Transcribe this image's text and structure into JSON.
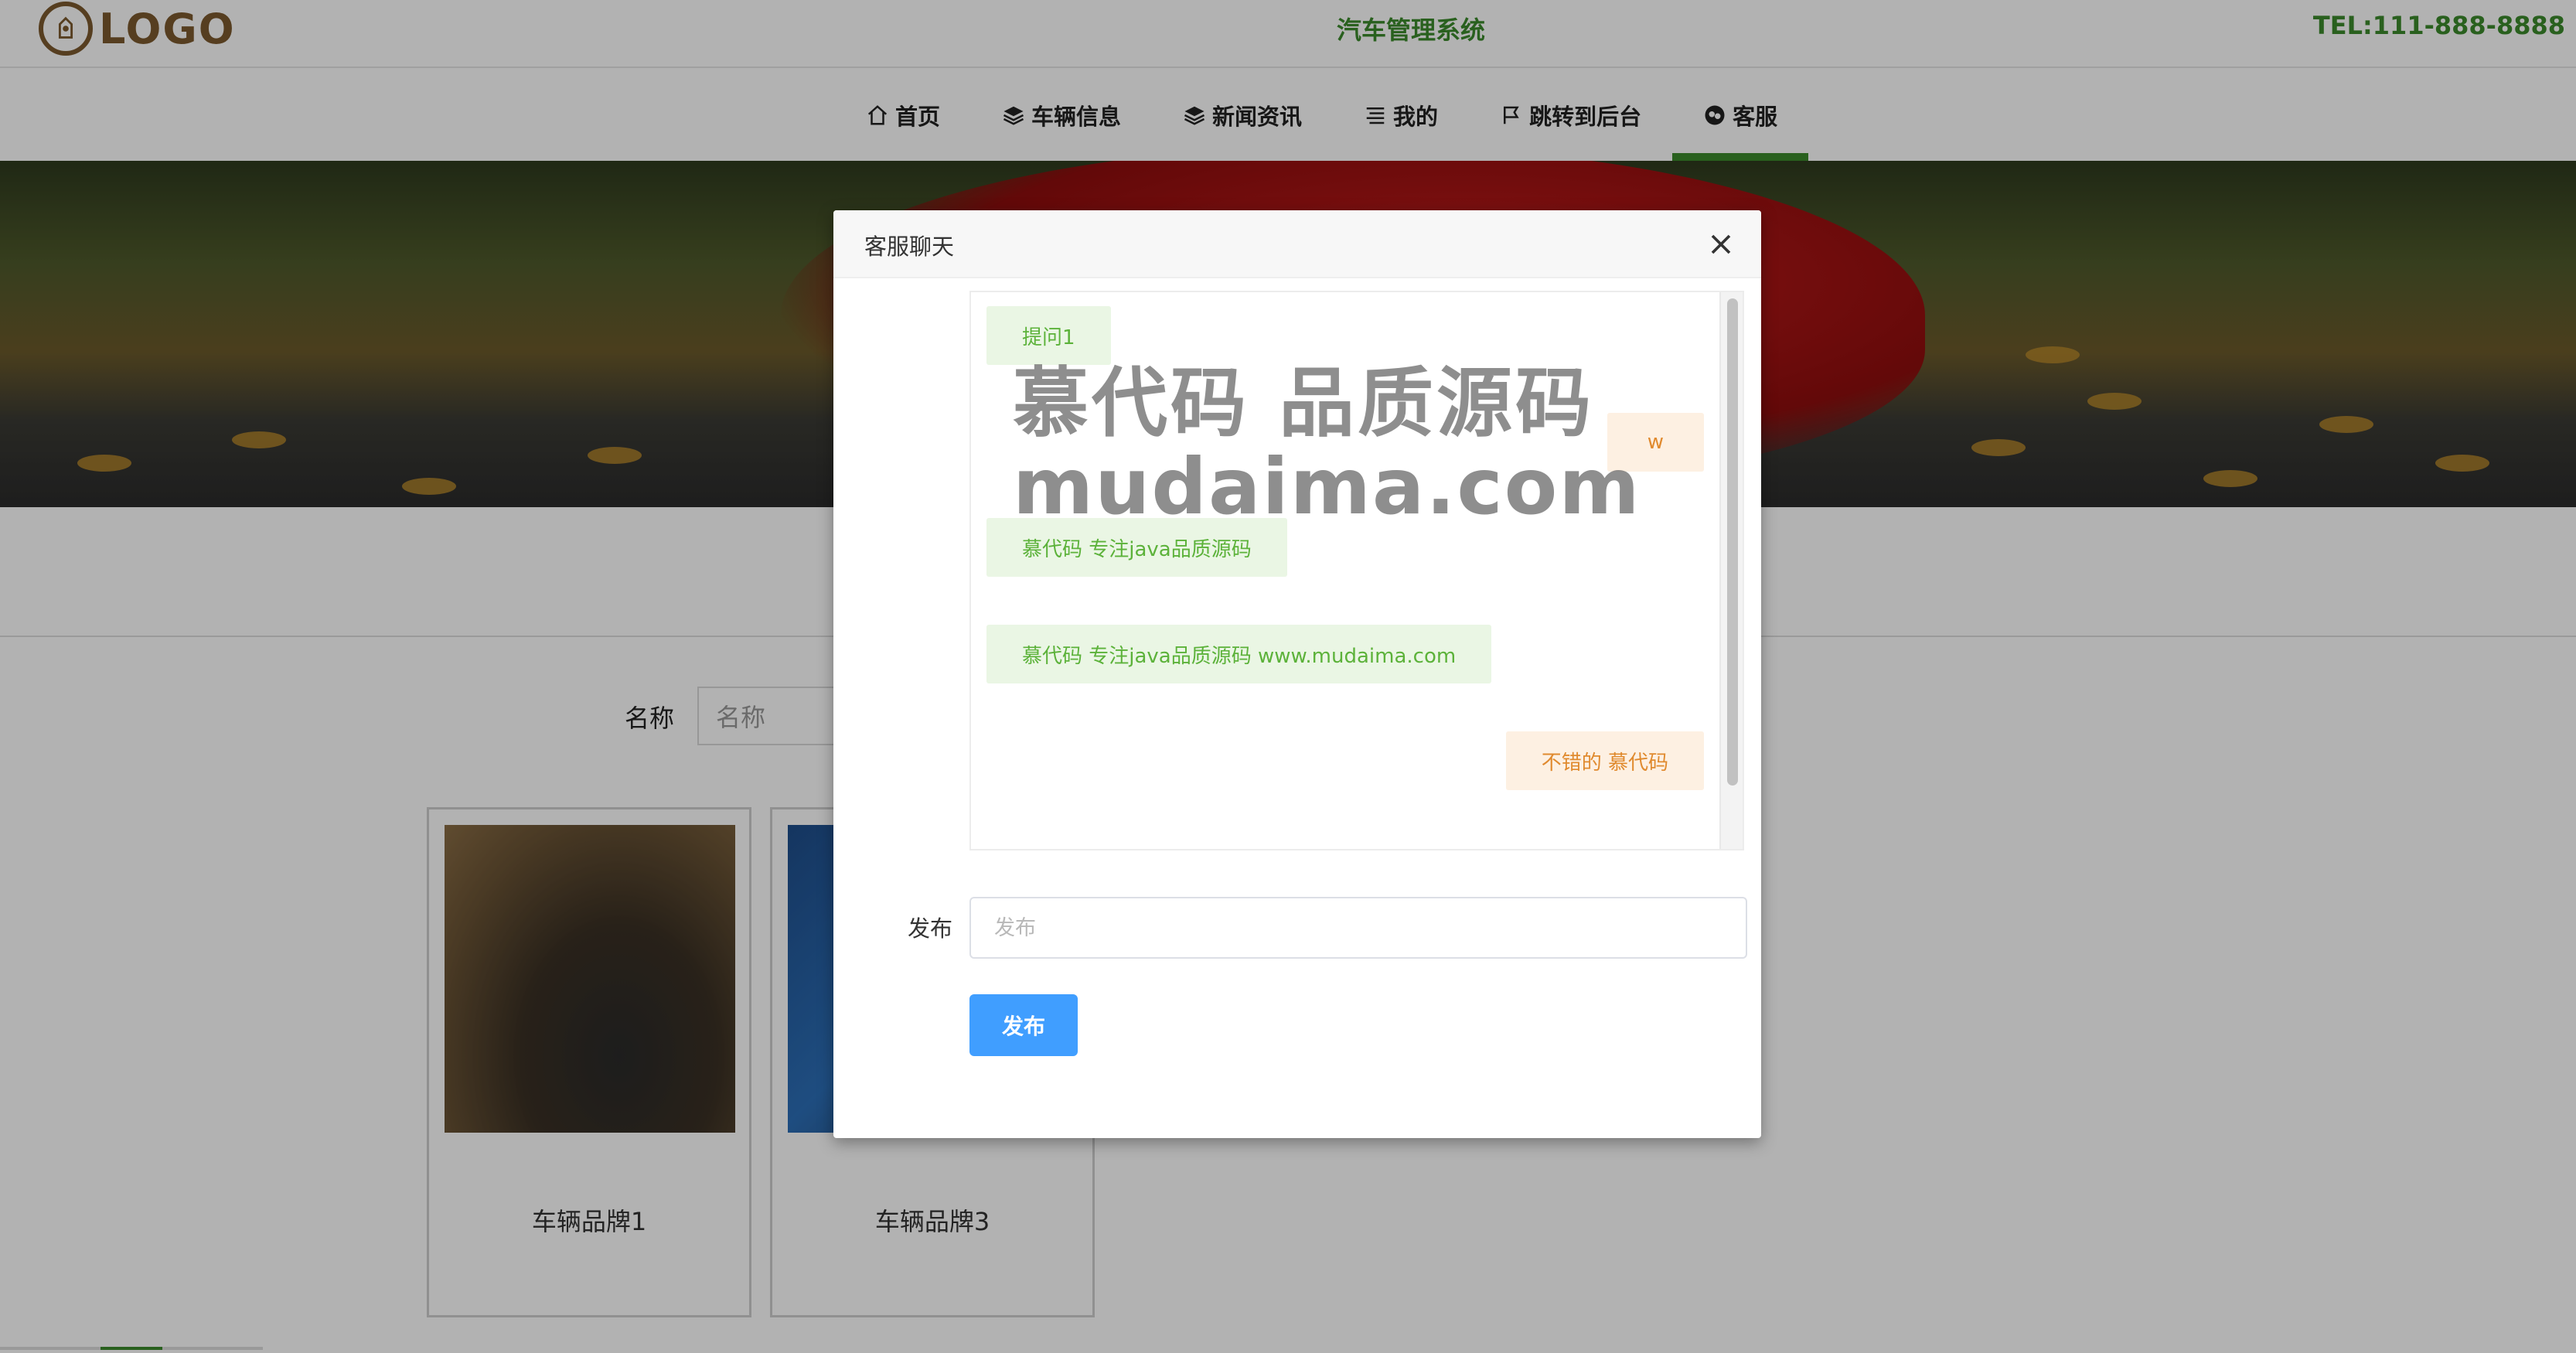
{
  "header": {
    "logo_text": "LOGO",
    "title": "汽车管理系统",
    "tel": "TEL:111-888-8888"
  },
  "nav": {
    "items": [
      {
        "label": "首页",
        "icon": "home-icon"
      },
      {
        "label": "车辆信息",
        "icon": "layers-icon"
      },
      {
        "label": "新闻资讯",
        "icon": "layers-icon"
      },
      {
        "label": "我的",
        "icon": "list-icon"
      },
      {
        "label": "跳转到后台",
        "icon": "flag-icon"
      },
      {
        "label": "客服",
        "icon": "wechat-icon"
      }
    ],
    "active_index": 5,
    "active_color": "#3b8a2c"
  },
  "search": {
    "label": "名称",
    "placeholder": "名称"
  },
  "cards": [
    {
      "label": "车辆品牌1"
    },
    {
      "label": "车辆品牌3"
    }
  ],
  "modal": {
    "title": "客服聊天",
    "messages": [
      {
        "side": "left",
        "text": "提问1"
      },
      {
        "side": "right",
        "text": "w"
      },
      {
        "side": "left",
        "text": "慕代码 专注java品质源码"
      },
      {
        "side": "left",
        "text": "慕代码 专注java品质源码 www.mudaima.com"
      },
      {
        "side": "right",
        "text": "不错的 慕代码"
      }
    ],
    "post_label": "发布",
    "post_placeholder": "发布",
    "post_button": "发布"
  },
  "watermark": {
    "line1": "慕代码 品质源码",
    "line2": "mudaima.com"
  },
  "colors": {
    "brand_green": "#3b8a2c",
    "logo_brown": "#7b5a2e",
    "primary_button": "#409eff",
    "left_bubble_bg": "#eaf6e4",
    "right_bubble_bg": "#fdf0e2"
  }
}
